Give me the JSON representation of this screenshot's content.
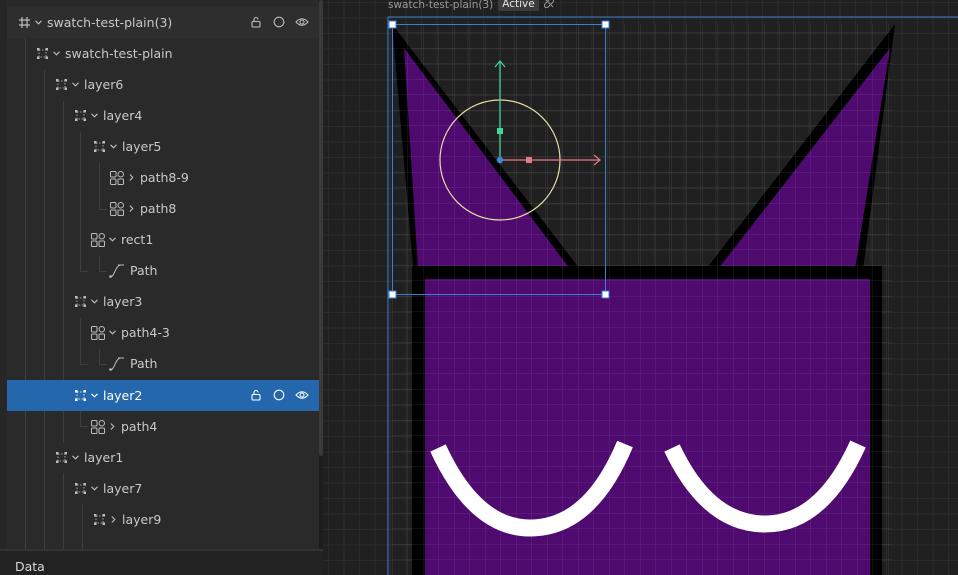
{
  "layers": {
    "root": {
      "label": "swatch-test-plain(3)"
    },
    "items": [
      {
        "label": "swatch-test-plain"
      },
      {
        "label": "layer6"
      },
      {
        "label": "layer4"
      },
      {
        "label": "layer5"
      },
      {
        "label": "path8-9"
      },
      {
        "label": "path8"
      },
      {
        "label": "rect1"
      },
      {
        "label": "Path"
      },
      {
        "label": "layer3"
      },
      {
        "label": "path4-3"
      },
      {
        "label": "Path"
      },
      {
        "label": "layer2"
      },
      {
        "label": "path4"
      },
      {
        "label": "layer1"
      },
      {
        "label": "layer7"
      },
      {
        "label": "layer9"
      }
    ]
  },
  "data_section": {
    "label": "Data"
  },
  "canvas": {
    "frame_name": "swatch-test-plain(3)",
    "status_badge": "Active",
    "colors": {
      "shape_fill": "#4e0a6e",
      "stroke": "#000000",
      "eyes": "#ffffff",
      "selection": "#3a7fd0",
      "gizmo_circle": "#e6dfa0",
      "axis_y": "#3fd69a",
      "axis_x": "#e57a82"
    }
  },
  "icons": {
    "frame": "frame-hash-icon",
    "group": "group-icon",
    "component": "component-icon",
    "path": "path-icon",
    "lock": "lock-icon",
    "visibility_toggle": "circle-icon",
    "eye": "eye-icon"
  }
}
